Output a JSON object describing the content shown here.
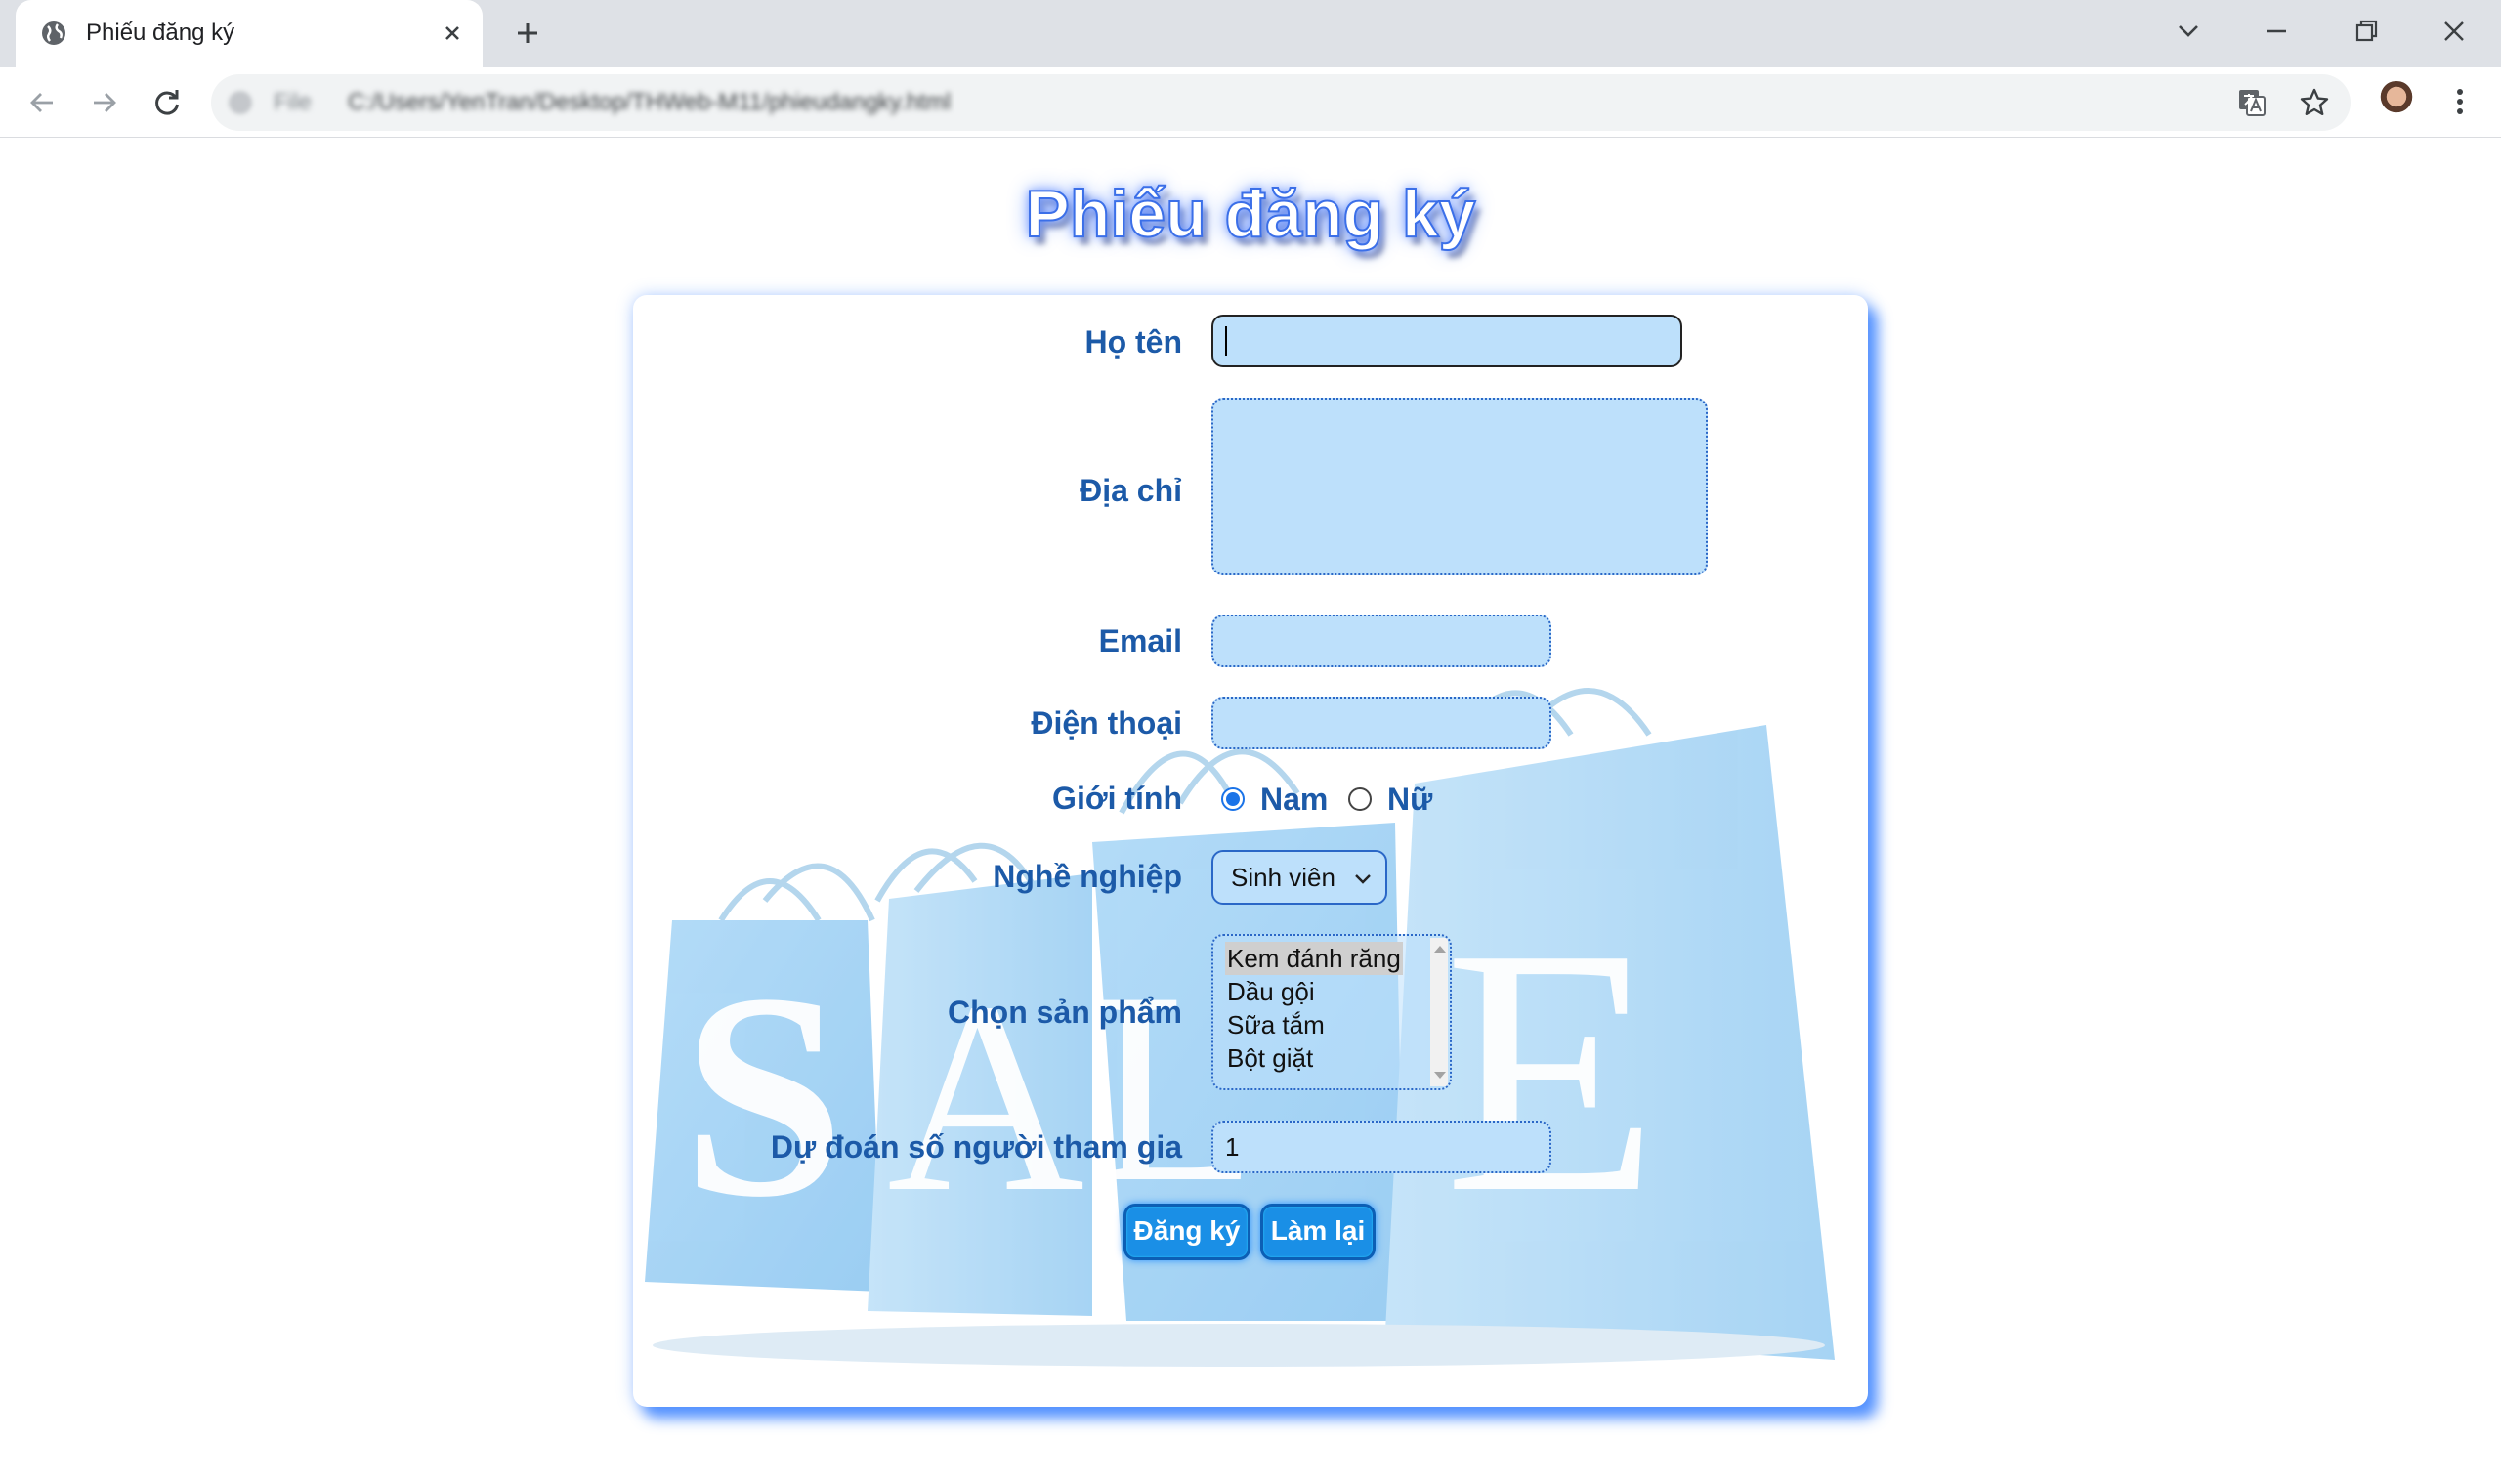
{
  "browser": {
    "tab_title": "Phiếu đăng ký",
    "address_prefix": "File",
    "address_url": "C:/Users/YenTran/Desktop/THWeb-M11/phieudangky.html"
  },
  "page": {
    "title": "Phiếu đăng ký"
  },
  "form": {
    "name_label": "Họ tên",
    "name_value": "",
    "address_label": "Địa chỉ",
    "address_value": "",
    "email_label": "Email",
    "email_value": "",
    "phone_label": "Điện thoại",
    "phone_value": "",
    "gender_label": "Giới tính",
    "gender_options": [
      "Nam",
      "Nữ"
    ],
    "gender_selected": "Nam",
    "job_label": "Nghề nghiệp",
    "job_selected": "Sinh viên",
    "product_label": "Chọn sản phẩm",
    "product_options": [
      "Kem đánh răng",
      "Dầu gội",
      "Sữa tắm",
      "Bột giặt"
    ],
    "product_selected": "Kem đánh răng",
    "count_label": "Dự đoán số người tham gia",
    "count_value": "1",
    "submit_label": "Đăng ký",
    "reset_label": "Làm lại"
  },
  "background": {
    "letters": [
      "S",
      "A",
      "L",
      "E"
    ]
  },
  "colors": {
    "label": "#1c5aa8",
    "input_fill": "#bde0fb",
    "button": "#1a8fe6",
    "card_shadow": "#3c82ff"
  }
}
